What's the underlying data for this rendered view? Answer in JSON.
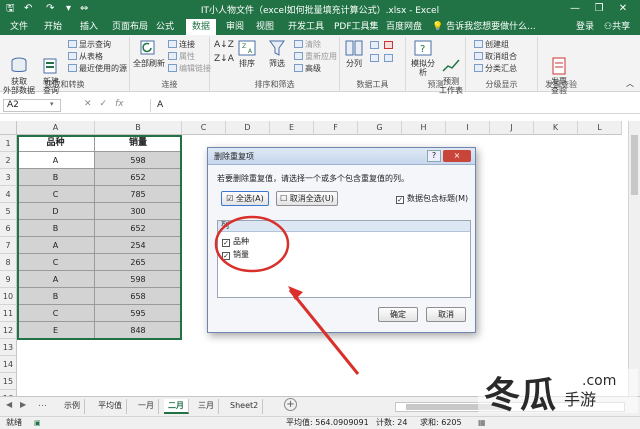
{
  "titlebar": {
    "title": "IT小人物文件（excel如何批量填充计算公式）.xlsx - Excel",
    "minimize_icon": "minimize-icon",
    "restore_icon": "restore-icon",
    "close_icon": "close-icon"
  },
  "tabs": {
    "file": "文件",
    "start": "开始",
    "insert": "插入",
    "layout": "页面布局",
    "formula": "公式",
    "data": "数据",
    "review": "审阅",
    "view": "视图",
    "dev": "开发工具",
    "pdf": "PDF工具集",
    "baidu": "百度网盘",
    "tell": "告诉我您想要做什么...",
    "login": "登录",
    "share": "共享"
  },
  "ribbon": {
    "get_external": "获取\n外部数据",
    "new_query": "新建\n查询",
    "show_query": "显示查询",
    "from_table": "从表格",
    "recent_sources": "最近使用的源",
    "group_get": "获取和转换",
    "refresh_all": "全部刷新",
    "connections": "连接",
    "properties": "属性",
    "edit_links": "编辑链接",
    "group_conn": "连接",
    "sort": "排序",
    "filter": "筛选",
    "clear": "清除",
    "reapply": "重新应用",
    "advanced": "高级",
    "group_sort": "排序和筛选",
    "split": "分列",
    "group_tools": "数据工具",
    "whatif": "模拟分析",
    "forecast": "预测\n工作表",
    "group_forecast": "预测",
    "create_group": "创建组",
    "ungroup": "取消组合",
    "subtotal": "分类汇总",
    "group_outline": "分级显示",
    "check": "发票\n查验",
    "group_check": "发票查验"
  },
  "formula_bar": {
    "name_box": "A2",
    "fx": "fx",
    "content": "A"
  },
  "grid": {
    "columns": [
      "A",
      "B",
      "C",
      "D",
      "E",
      "F",
      "G",
      "H",
      "I",
      "J",
      "K",
      "L"
    ],
    "rows": [
      "1",
      "2",
      "3",
      "4",
      "5",
      "6",
      "7",
      "8",
      "9",
      "10",
      "11",
      "12",
      "13",
      "14",
      "15",
      "16"
    ],
    "headers": [
      "品种",
      "销量"
    ],
    "data": [
      [
        "A",
        "598"
      ],
      [
        "B",
        "652"
      ],
      [
        "C",
        "785"
      ],
      [
        "D",
        "300"
      ],
      [
        "B",
        "652"
      ],
      [
        "A",
        "254"
      ],
      [
        "C",
        "265"
      ],
      [
        "A",
        "598"
      ],
      [
        "B",
        "658"
      ],
      [
        "C",
        "595"
      ],
      [
        "E",
        "848"
      ]
    ]
  },
  "dialog": {
    "title": "删除重复项",
    "help": "?",
    "close": "×",
    "instruction": "若要删除重复值，请选择一个或多个包含重复值的列。",
    "select_all": "全选(A)",
    "unselect_all": "取消全选(U)",
    "has_headers": "数据包含标题(M)",
    "list_header": "列",
    "columns": [
      "品种",
      "销量"
    ],
    "ok": "确定",
    "cancel": "取消"
  },
  "sheets": {
    "tabs": [
      "示例",
      "平均值",
      "一月",
      "二月",
      "三月",
      "Sheet2"
    ],
    "active": "二月"
  },
  "status": {
    "ready": "就绪",
    "average": "平均值: 564.0909091",
    "count": "计数: 24",
    "sum": "求和: 6205"
  },
  "colors": {
    "accent": "#217346",
    "annotation": "#d9302b"
  },
  "watermark": {
    "text": "冬瓜手游",
    "domain": ".com"
  }
}
